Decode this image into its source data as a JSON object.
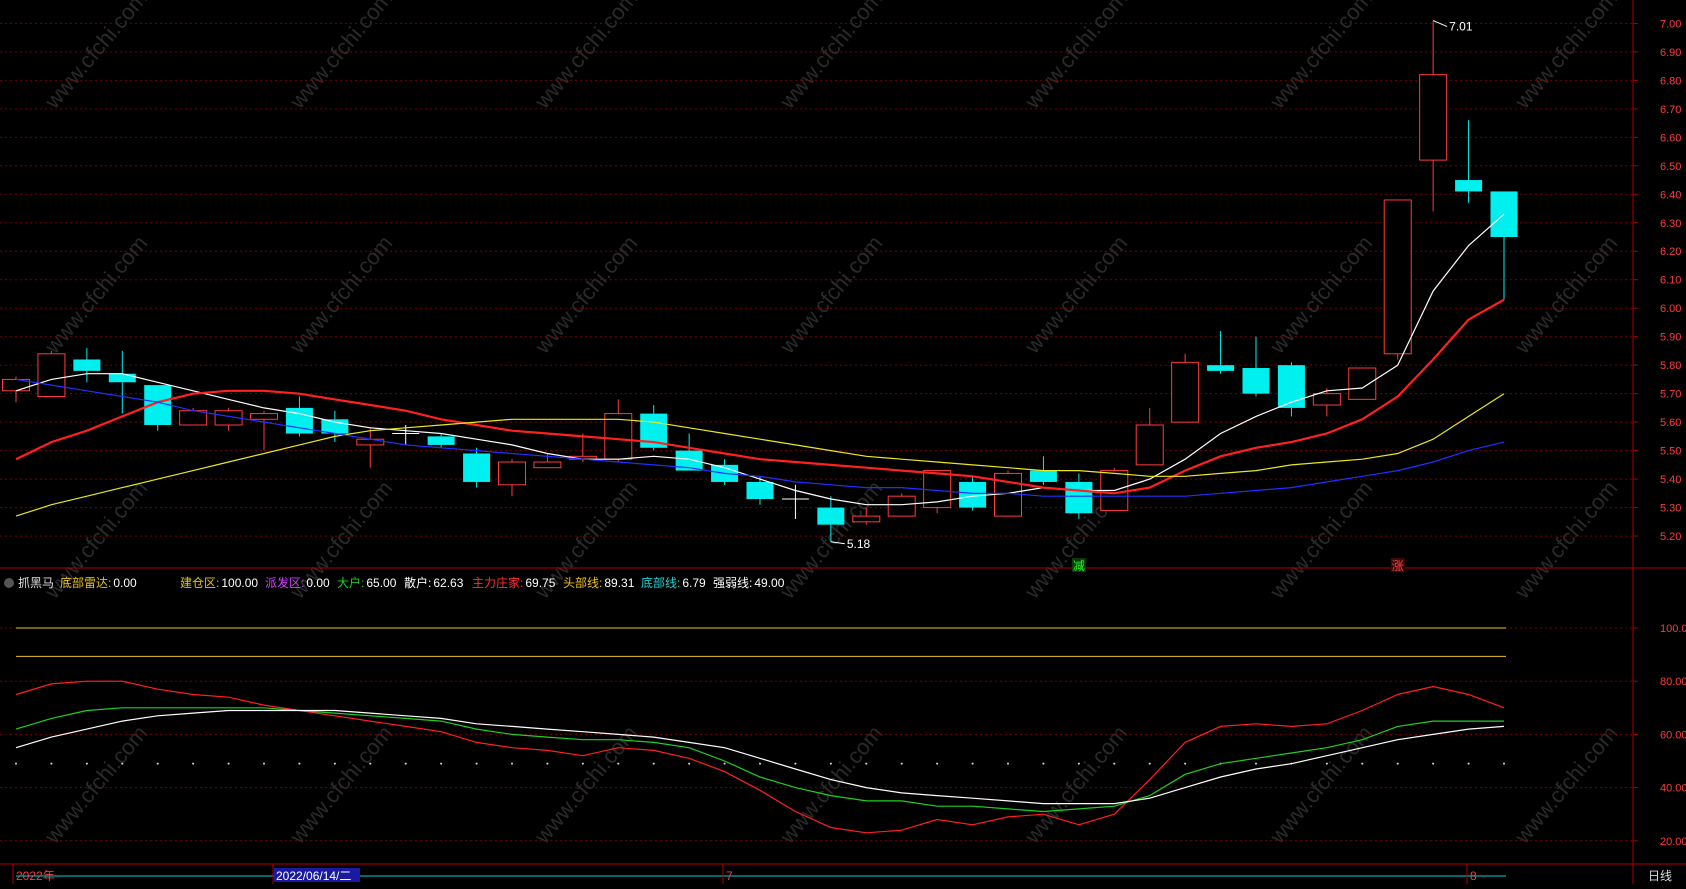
{
  "title_strip": "",
  "colors": {
    "up": "#ff3b3b",
    "down": "#00f0f0",
    "ma_white": "#ffffff",
    "ma_red": "#ff2020",
    "ma_yellow": "#e8e820",
    "ma_blue": "#2030ff",
    "grid": "#7a0000",
    "axis": "#b00000",
    "radar_red": "#ff2020",
    "radar_green": "#20d020",
    "radar_white": "#ffffff",
    "top_line": "#e8c020",
    "bottom_cyan": "#00d0d0",
    "bottom_magenta": "#ff20ff"
  },
  "price_axis": {
    "ticks": [
      "7.00",
      "6.90",
      "6.80",
      "6.70",
      "6.60",
      "6.50",
      "6.40",
      "6.30",
      "6.20",
      "6.10",
      "6.00",
      "5.90",
      "5.80",
      "5.70",
      "5.60",
      "5.50",
      "5.40",
      "5.30",
      "5.20"
    ]
  },
  "annotations": {
    "high_label": "7.01",
    "low_label": "5.18",
    "signal_green": "减",
    "signal_red": "涨"
  },
  "indicator": {
    "name": "抓黑马",
    "items": [
      {
        "label": "底部雷达:",
        "value": "0.00",
        "color": "#e8c020"
      },
      {
        "label": "建仓区:",
        "value": "100.00",
        "color": "#e8c020"
      },
      {
        "label": "派发区:",
        "value": "0.00",
        "color": "#d040ff"
      },
      {
        "label": "大户:",
        "value": "65.00",
        "color": "#20d020"
      },
      {
        "label": "散户:",
        "value": "62.63",
        "color": "#ffffff"
      },
      {
        "label": "主力庄家:",
        "value": "69.75",
        "color": "#ff3030"
      },
      {
        "label": "头部线:",
        "value": "89.31",
        "color": "#e8c020"
      },
      {
        "label": "底部线:",
        "value": "6.79",
        "color": "#20d0d0"
      },
      {
        "label": "强弱线:",
        "value": "49.00",
        "color": "#ffffff"
      }
    ],
    "axis_ticks": [
      "100.00",
      "80.00",
      "60.00",
      "40.00",
      "20.00"
    ]
  },
  "date_axis": {
    "labels": [
      "2022年",
      "2022/06/14/二",
      "7",
      "8"
    ],
    "period": "日线"
  },
  "chart_data": [
    {
      "type": "candlestick",
      "ylim": [
        5.13,
        7.04
      ],
      "candles": [
        {
          "o": 5.71,
          "h": 5.76,
          "l": 5.67,
          "c": 5.75
        },
        {
          "o": 5.69,
          "h": 5.85,
          "l": 5.69,
          "c": 5.84
        },
        {
          "o": 5.82,
          "h": 5.86,
          "l": 5.74,
          "c": 5.78
        },
        {
          "o": 5.77,
          "h": 5.85,
          "l": 5.63,
          "c": 5.74
        },
        {
          "o": 5.73,
          "h": 5.73,
          "l": 5.57,
          "c": 5.59
        },
        {
          "o": 5.59,
          "h": 5.65,
          "l": 5.59,
          "c": 5.64
        },
        {
          "o": 5.59,
          "h": 5.65,
          "l": 5.57,
          "c": 5.64
        },
        {
          "o": 5.61,
          "h": 5.64,
          "l": 5.5,
          "c": 5.63
        },
        {
          "o": 5.65,
          "h": 5.69,
          "l": 5.55,
          "c": 5.56
        },
        {
          "o": 5.61,
          "h": 5.64,
          "l": 5.53,
          "c": 5.56
        },
        {
          "o": 5.52,
          "h": 5.58,
          "l": 5.44,
          "c": 5.54
        },
        {
          "o": 5.56,
          "h": 5.59,
          "l": 5.52,
          "c": 5.56
        },
        {
          "o": 5.55,
          "h": 5.56,
          "l": 5.51,
          "c": 5.52
        },
        {
          "o": 5.49,
          "h": 5.51,
          "l": 5.37,
          "c": 5.39
        },
        {
          "o": 5.38,
          "h": 5.47,
          "l": 5.34,
          "c": 5.46
        },
        {
          "o": 5.44,
          "h": 5.49,
          "l": 5.44,
          "c": 5.46
        },
        {
          "o": 5.47,
          "h": 5.56,
          "l": 5.46,
          "c": 5.48
        },
        {
          "o": 5.47,
          "h": 5.68,
          "l": 5.46,
          "c": 5.63
        },
        {
          "o": 5.63,
          "h": 5.66,
          "l": 5.5,
          "c": 5.51
        },
        {
          "o": 5.5,
          "h": 5.56,
          "l": 5.43,
          "c": 5.43
        },
        {
          "o": 5.45,
          "h": 5.47,
          "l": 5.38,
          "c": 5.39
        },
        {
          "o": 5.39,
          "h": 5.41,
          "l": 5.31,
          "c": 5.33
        },
        {
          "o": 5.33,
          "h": 5.38,
          "l": 5.26,
          "c": 5.33
        },
        {
          "o": 5.3,
          "h": 5.34,
          "l": 5.18,
          "c": 5.24
        },
        {
          "o": 5.25,
          "h": 5.3,
          "l": 5.24,
          "c": 5.27
        },
        {
          "o": 5.27,
          "h": 5.35,
          "l": 5.27,
          "c": 5.34
        },
        {
          "o": 5.3,
          "h": 5.43,
          "l": 5.28,
          "c": 5.43
        },
        {
          "o": 5.39,
          "h": 5.41,
          "l": 5.29,
          "c": 5.3
        },
        {
          "o": 5.27,
          "h": 5.43,
          "l": 5.27,
          "c": 5.42
        },
        {
          "o": 5.43,
          "h": 5.48,
          "l": 5.38,
          "c": 5.39
        },
        {
          "o": 5.39,
          "h": 5.42,
          "l": 5.26,
          "c": 5.28
        },
        {
          "o": 5.29,
          "h": 5.44,
          "l": 5.29,
          "c": 5.43
        },
        {
          "o": 5.45,
          "h": 5.65,
          "l": 5.45,
          "c": 5.59
        },
        {
          "o": 5.6,
          "h": 5.84,
          "l": 5.6,
          "c": 5.81
        },
        {
          "o": 5.8,
          "h": 5.92,
          "l": 5.77,
          "c": 5.78
        },
        {
          "o": 5.79,
          "h": 5.9,
          "l": 5.69,
          "c": 5.7
        },
        {
          "o": 5.8,
          "h": 5.81,
          "l": 5.62,
          "c": 5.65
        },
        {
          "o": 5.66,
          "h": 5.72,
          "l": 5.62,
          "c": 5.7
        },
        {
          "o": 5.68,
          "h": 5.79,
          "l": 5.68,
          "c": 5.79
        },
        {
          "o": 5.84,
          "h": 6.38,
          "l": 5.82,
          "c": 6.38
        },
        {
          "o": 6.52,
          "h": 7.01,
          "l": 6.34,
          "c": 6.82
        },
        {
          "o": 6.45,
          "h": 6.66,
          "l": 6.37,
          "c": 6.41
        },
        {
          "o": 6.41,
          "h": 6.41,
          "l": 6.03,
          "c": 6.25
        }
      ],
      "ma": [
        {
          "name": "ma_white",
          "values": [
            5.71,
            5.75,
            5.77,
            5.77,
            5.74,
            5.71,
            5.68,
            5.65,
            5.63,
            5.6,
            5.58,
            5.57,
            5.56,
            5.54,
            5.52,
            5.49,
            5.47,
            5.47,
            5.48,
            5.47,
            5.44,
            5.4,
            5.36,
            5.33,
            5.31,
            5.31,
            5.32,
            5.34,
            5.35,
            5.37,
            5.36,
            5.36,
            5.4,
            5.47,
            5.56,
            5.62,
            5.67,
            5.71,
            5.72,
            5.8,
            6.06,
            6.22,
            6.33
          ]
        },
        {
          "name": "ma_red",
          "values": [
            5.47,
            5.53,
            5.57,
            5.62,
            5.67,
            5.7,
            5.71,
            5.71,
            5.7,
            5.68,
            5.66,
            5.64,
            5.61,
            5.59,
            5.57,
            5.56,
            5.55,
            5.54,
            5.53,
            5.51,
            5.49,
            5.47,
            5.46,
            5.45,
            5.44,
            5.43,
            5.42,
            5.41,
            5.39,
            5.37,
            5.36,
            5.35,
            5.37,
            5.43,
            5.48,
            5.51,
            5.53,
            5.56,
            5.61,
            5.69,
            5.82,
            5.96,
            6.03
          ]
        },
        {
          "name": "ma_yellow",
          "values": [
            5.27,
            5.31,
            5.34,
            5.37,
            5.4,
            5.43,
            5.46,
            5.49,
            5.52,
            5.55,
            5.57,
            5.58,
            5.59,
            5.6,
            5.61,
            5.61,
            5.61,
            5.61,
            5.6,
            5.58,
            5.56,
            5.54,
            5.52,
            5.5,
            5.48,
            5.47,
            5.46,
            5.45,
            5.44,
            5.43,
            5.43,
            5.42,
            5.41,
            5.41,
            5.42,
            5.43,
            5.45,
            5.46,
            5.47,
            5.49,
            5.54,
            5.62,
            5.7
          ]
        },
        {
          "name": "ma_blue",
          "values": [
            5.75,
            5.73,
            5.71,
            5.69,
            5.67,
            5.64,
            5.62,
            5.6,
            5.58,
            5.56,
            5.54,
            5.52,
            5.51,
            5.5,
            5.49,
            5.48,
            5.47,
            5.46,
            5.45,
            5.44,
            5.42,
            5.41,
            5.39,
            5.38,
            5.37,
            5.37,
            5.36,
            5.35,
            5.35,
            5.34,
            5.34,
            5.34,
            5.34,
            5.34,
            5.35,
            5.36,
            5.37,
            5.39,
            5.41,
            5.43,
            5.46,
            5.5,
            5.53
          ]
        }
      ],
      "signal_index": {
        "green": 30,
        "red": 39
      }
    },
    {
      "type": "line",
      "ylim": [
        0,
        105
      ],
      "series": [
        {
          "name": "主力庄家",
          "values": [
            75,
            79,
            80,
            80,
            77,
            75,
            74,
            71,
            69,
            67,
            65,
            63,
            61,
            57,
            55,
            54,
            52,
            55,
            54,
            51,
            46,
            39,
            31,
            25,
            23,
            24,
            28,
            26,
            29,
            30,
            26,
            30,
            43,
            57,
            63,
            64,
            63,
            64,
            69,
            75,
            78,
            75,
            70
          ]
        },
        {
          "name": "大户",
          "values": [
            62,
            66,
            69,
            70,
            70,
            70,
            70,
            70,
            69,
            68,
            67,
            66,
            65,
            62,
            60,
            59,
            58,
            58,
            57,
            55,
            50,
            44,
            40,
            37,
            35,
            35,
            33,
            33,
            32,
            31,
            32,
            33,
            37,
            45,
            49,
            51,
            53,
            55,
            58,
            63,
            65,
            65,
            65
          ]
        },
        {
          "name": "散户",
          "values": [
            55,
            59,
            62,
            65,
            67,
            68,
            69,
            69,
            69,
            69,
            68,
            67,
            66,
            64,
            63,
            62,
            61,
            60,
            59,
            57,
            55,
            51,
            47,
            43,
            40,
            38,
            37,
            36,
            35,
            34,
            34,
            34,
            36,
            40,
            44,
            47,
            49,
            52,
            55,
            58,
            60,
            62,
            63
          ]
        }
      ],
      "lines": {
        "top1": 100,
        "top2": 89.31,
        "bottom_cyan": 6.79,
        "bottom_magenta": 0,
        "dotted": 49
      }
    }
  ]
}
